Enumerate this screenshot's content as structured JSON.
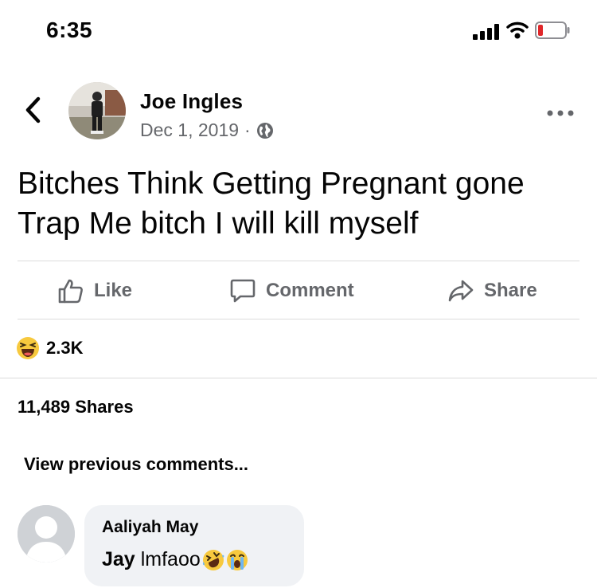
{
  "status_bar": {
    "time": "6:35"
  },
  "post": {
    "author": "Joe Ingles",
    "date": "Dec 1, 2019",
    "separator": "·",
    "text": "Bitches Think Getting Pregnant gone Trap Me bitch I will kill myself"
  },
  "actions": {
    "like": "Like",
    "comment": "Comment",
    "share": "Share"
  },
  "reactions": {
    "count": "2.3K",
    "icon": "laughing-emoji-icon"
  },
  "shares": "11,489 Shares",
  "view_previous": "View previous comments...",
  "comment": {
    "name": "Aaliyah May",
    "mention": "Jay",
    "text": "lmfaoo",
    "emojis": [
      "rofl-emoji-icon",
      "crying-emoji-icon"
    ]
  },
  "colors": {
    "text": "#050505",
    "secondary": "#65676b",
    "bubble": "#f0f2f5",
    "battery_low": "#e0272a"
  }
}
